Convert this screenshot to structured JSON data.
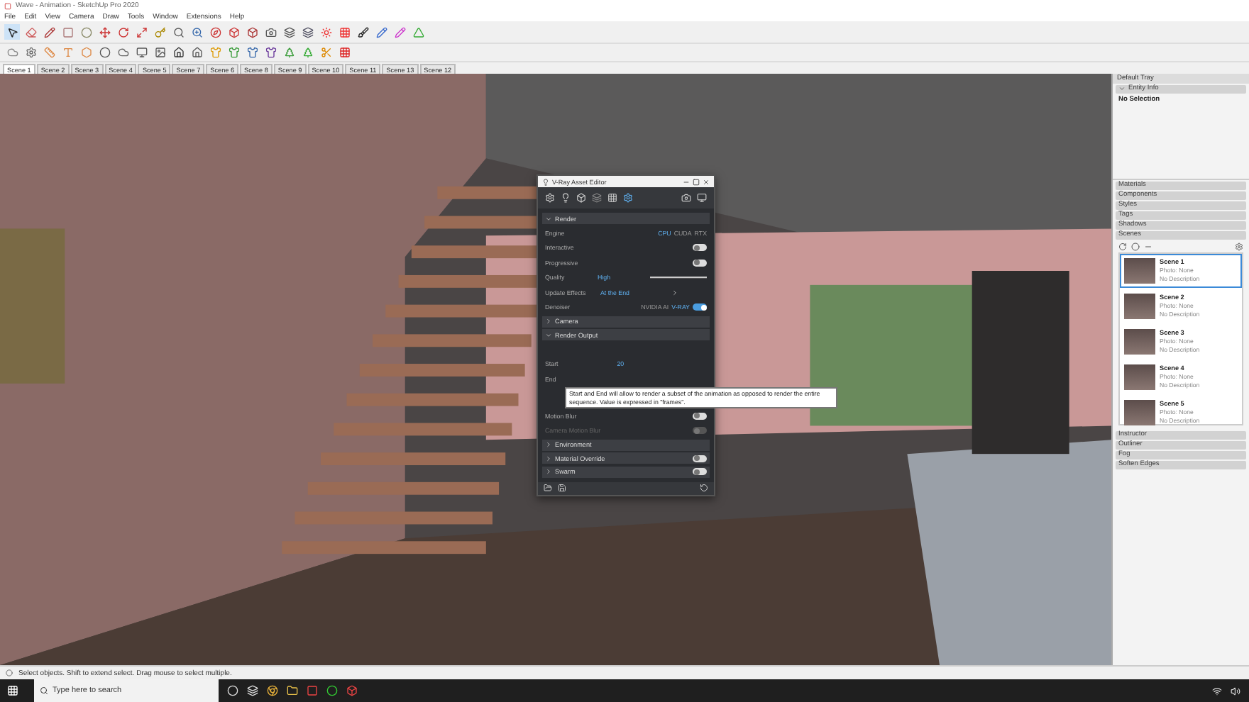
{
  "window": {
    "title": "Wave - Animation - SketchUp Pro 2020"
  },
  "menu": [
    "File",
    "Edit",
    "View",
    "Camera",
    "Draw",
    "Tools",
    "Window",
    "Extensions",
    "Help"
  ],
  "scene_tabs": [
    {
      "label": "Scene 1",
      "selected": true
    },
    {
      "label": "Scene 2",
      "selected": false
    },
    {
      "label": "Scene 3",
      "selected": false
    },
    {
      "label": "Scene 4",
      "selected": false
    },
    {
      "label": "Scene 5",
      "selected": false
    },
    {
      "label": "Scene 7",
      "selected": false
    },
    {
      "label": "Scene 6",
      "selected": false
    },
    {
      "label": "Scene 8",
      "selected": false
    },
    {
      "label": "Scene 9",
      "selected": false
    },
    {
      "label": "Scene 10",
      "selected": false
    },
    {
      "label": "Scene 11",
      "selected": false
    },
    {
      "label": "Scene 13",
      "selected": false
    },
    {
      "label": "Scene 12",
      "selected": false
    }
  ],
  "vray_editor": {
    "title": "V-Ray Asset Editor",
    "rows": [
      {
        "kind": "header",
        "label": "Render",
        "expanded": true
      },
      {
        "kind": "segmented",
        "label": "Engine",
        "options": [
          {
            "label": "CPU",
            "selected": true
          },
          {
            "label": "CUDA",
            "selected": false
          },
          {
            "label": "RTX",
            "selected": false
          }
        ]
      },
      {
        "kind": "toggle",
        "label": "Interactive",
        "on": false
      },
      {
        "kind": "toggle",
        "label": "Progressive",
        "on": false
      },
      {
        "kind": "slider",
        "label": "Quality",
        "value": "High",
        "level": 1
      },
      {
        "kind": "dropdown",
        "label": "Update Effects",
        "value": "At the End"
      },
      {
        "kind": "denoiser",
        "label": "Denoiser",
        "options": [
          {
            "label": "NVIDIA AI",
            "selected": false
          },
          {
            "label": "V-RAY",
            "selected": true
          }
        ],
        "on": true
      },
      {
        "kind": "header",
        "label": "Camera",
        "expanded": false
      },
      {
        "kind": "header",
        "label": "Render Output",
        "expanded": true
      },
      {
        "kind": "spacer"
      },
      {
        "kind": "field",
        "label": "Start",
        "value": "20"
      },
      {
        "kind": "field",
        "label": "End"
      },
      {
        "kind": "spacer",
        "tip": true
      },
      {
        "kind": "toggle",
        "label": "Motion Blur",
        "on": false
      },
      {
        "kind": "toggle",
        "label": "Camera Motion Blur",
        "on": false,
        "disabled": true
      },
      {
        "kind": "header",
        "label": "Environment",
        "expanded": false
      },
      {
        "kind": "header_toggle",
        "label": "Material Override",
        "expanded": false,
        "on": false
      },
      {
        "kind": "header_toggle",
        "label": "Swarm",
        "expanded": false,
        "on": false
      }
    ]
  },
  "tooltip": "Start and End will allow to render a subset of the animation as opposed to render the entire sequence. Value is expressed in \"frames\".",
  "tray": {
    "title": "Default Tray",
    "entity_info": {
      "title": "Entity Info",
      "text": "No Selection"
    },
    "panels_top": [
      "Materials",
      "Components",
      "Styles",
      "Tags",
      "Shadows"
    ],
    "scenes_title": "Scenes",
    "scenes": [
      {
        "name": "Scene 1",
        "photo": "Photo: None",
        "description": "No Description",
        "selected": true
      },
      {
        "name": "Scene 2",
        "photo": "Photo: None",
        "description": "No Description",
        "selected": false
      },
      {
        "name": "Scene 3",
        "photo": "Photo: None",
        "description": "No Description",
        "selected": false
      },
      {
        "name": "Scene 4",
        "photo": "Photo: None",
        "description": "No Description",
        "selected": false
      },
      {
        "name": "Scene 5",
        "photo": "Photo: None",
        "description": "No Description",
        "selected": false
      }
    ],
    "panels_bottom": [
      "Instructor",
      "Outliner",
      "Fog",
      "Soften Edges"
    ]
  },
  "status_bar": "Select objects. Shift to extend select. Drag mouse to select multiple.",
  "taskbar": {
    "search_placeholder": "Type here to search"
  }
}
